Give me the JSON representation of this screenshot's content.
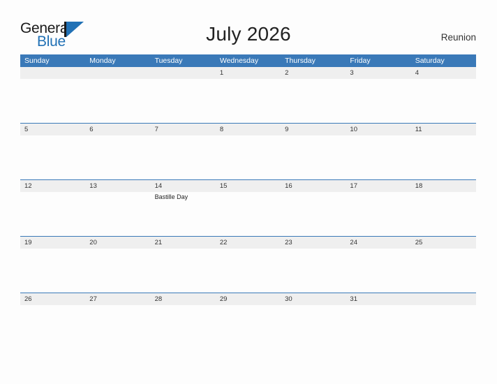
{
  "brand": {
    "name_part1": "General",
    "name_part2": "Blue",
    "logo_icon": "flag-triangle-icon",
    "accent_color": "#2171b5"
  },
  "header": {
    "title": "July 2026",
    "region": "Reunion"
  },
  "calendar": {
    "month": "July",
    "year": "2026",
    "header_color": "#3a79b8",
    "band_color": "#efefef",
    "weekdays": [
      "Sunday",
      "Monday",
      "Tuesday",
      "Wednesday",
      "Thursday",
      "Friday",
      "Saturday"
    ],
    "weeks": [
      {
        "days": [
          {
            "date": "",
            "event": ""
          },
          {
            "date": "",
            "event": ""
          },
          {
            "date": "",
            "event": ""
          },
          {
            "date": "1",
            "event": ""
          },
          {
            "date": "2",
            "event": ""
          },
          {
            "date": "3",
            "event": ""
          },
          {
            "date": "4",
            "event": ""
          }
        ]
      },
      {
        "days": [
          {
            "date": "5",
            "event": ""
          },
          {
            "date": "6",
            "event": ""
          },
          {
            "date": "7",
            "event": ""
          },
          {
            "date": "8",
            "event": ""
          },
          {
            "date": "9",
            "event": ""
          },
          {
            "date": "10",
            "event": ""
          },
          {
            "date": "11",
            "event": ""
          }
        ]
      },
      {
        "days": [
          {
            "date": "12",
            "event": ""
          },
          {
            "date": "13",
            "event": ""
          },
          {
            "date": "14",
            "event": "Bastille Day"
          },
          {
            "date": "15",
            "event": ""
          },
          {
            "date": "16",
            "event": ""
          },
          {
            "date": "17",
            "event": ""
          },
          {
            "date": "18",
            "event": ""
          }
        ]
      },
      {
        "days": [
          {
            "date": "19",
            "event": ""
          },
          {
            "date": "20",
            "event": ""
          },
          {
            "date": "21",
            "event": ""
          },
          {
            "date": "22",
            "event": ""
          },
          {
            "date": "23",
            "event": ""
          },
          {
            "date": "24",
            "event": ""
          },
          {
            "date": "25",
            "event": ""
          }
        ]
      },
      {
        "days": [
          {
            "date": "26",
            "event": ""
          },
          {
            "date": "27",
            "event": ""
          },
          {
            "date": "28",
            "event": ""
          },
          {
            "date": "29",
            "event": ""
          },
          {
            "date": "30",
            "event": ""
          },
          {
            "date": "31",
            "event": ""
          },
          {
            "date": "",
            "event": ""
          }
        ]
      }
    ]
  }
}
